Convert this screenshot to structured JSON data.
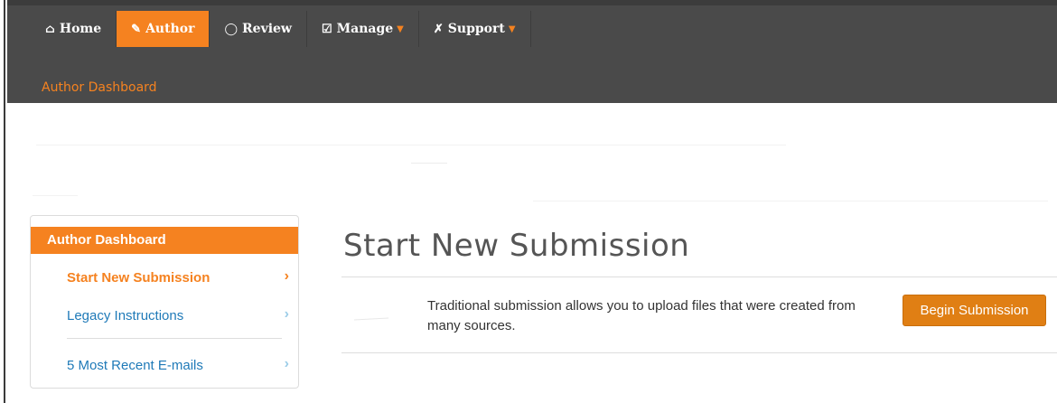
{
  "nav": {
    "items": [
      {
        "label": "Home",
        "icon": "home-icon",
        "glyph": "🏠"
      },
      {
        "label": "Author",
        "icon": "pencil-icon",
        "glyph": "✎"
      },
      {
        "label": "Review",
        "icon": "comment-icon",
        "glyph": "◯"
      },
      {
        "label": "Manage",
        "icon": "checkbox-icon",
        "glyph": "☑"
      },
      {
        "label": "Support",
        "icon": "wrench-icon",
        "glyph": "🔧"
      }
    ],
    "active": "Author"
  },
  "subnav": {
    "current": "Author Dashboard"
  },
  "sidebar": {
    "title": "Author Dashboard",
    "items": [
      {
        "label": "Start New Submission"
      },
      {
        "label": "Legacy Instructions"
      },
      {
        "label": "5 Most Recent E-mails"
      }
    ]
  },
  "main": {
    "title": "Start New Submission",
    "description": "Traditional submission allows you to upload files that were created from many sources.",
    "begin_button": "Begin Submission"
  },
  "colors": {
    "accent": "#f58220",
    "topbar": "#4a4a4a",
    "link": "#1f7ab8"
  }
}
